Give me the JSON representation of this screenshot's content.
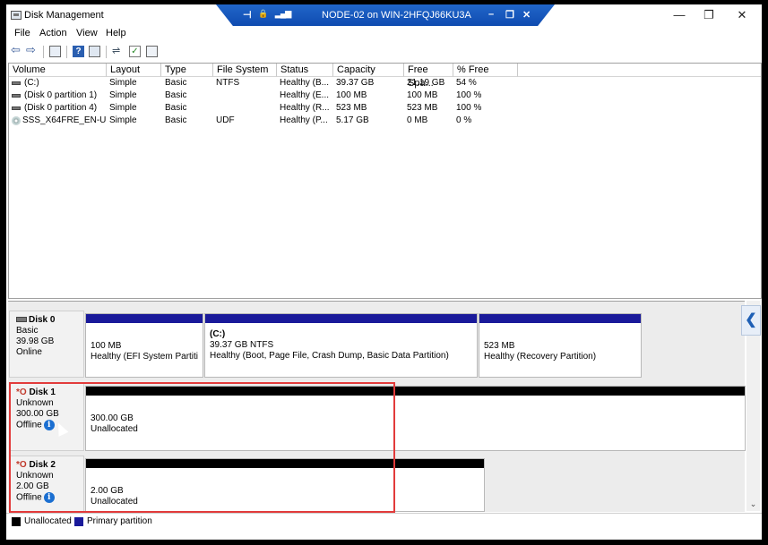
{
  "window": {
    "title": "Disk Management",
    "minimize": "—",
    "restore": "❐",
    "close": "✕"
  },
  "remote_bar": {
    "title": "NODE-02 on WIN-2HFQJ66KU3A",
    "pin": "⊣",
    "lock": "🔒",
    "signal": "▮",
    "minimize": "–",
    "restore": "❐",
    "close": "✕"
  },
  "menu": [
    "File",
    "Action",
    "View",
    "Help"
  ],
  "columns": [
    "Volume",
    "Layout",
    "Type",
    "File System",
    "Status",
    "Capacity",
    "Free Spa...",
    "% Free"
  ],
  "volumes": [
    {
      "volume": "(C:)",
      "layout": "Simple",
      "type": "Basic",
      "fs": "NTFS",
      "status": "Healthy (B...",
      "capacity": "39.37 GB",
      "free": "21.19 GB",
      "pct": "54 %",
      "icon": "drive-icon"
    },
    {
      "volume": "(Disk 0 partition 1)",
      "layout": "Simple",
      "type": "Basic",
      "fs": "",
      "status": "Healthy (E...",
      "capacity": "100 MB",
      "free": "100 MB",
      "pct": "100 %",
      "icon": "drive-icon"
    },
    {
      "volume": "(Disk 0 partition 4)",
      "layout": "Simple",
      "type": "Basic",
      "fs": "",
      "status": "Healthy (R...",
      "capacity": "523 MB",
      "free": "523 MB",
      "pct": "100 %",
      "icon": "drive-icon"
    },
    {
      "volume": "SSS_X64FRE_EN-U...",
      "layout": "Simple",
      "type": "Basic",
      "fs": "UDF",
      "status": "Healthy (P...",
      "capacity": "5.17 GB",
      "free": "0 MB",
      "pct": "0 %",
      "icon": "disc-icon"
    }
  ],
  "disks": [
    {
      "name": "Disk 0",
      "type": "Basic",
      "size": "39.98 GB",
      "state": "Online",
      "partitions": [
        {
          "label": "",
          "size": "100 MB",
          "status": "Healthy (EFI System Partitio"
        },
        {
          "label": "(C:)",
          "size": "39.37 GB NTFS",
          "status": "Healthy (Boot, Page File, Crash Dump, Basic Data Partition)"
        },
        {
          "label": "",
          "size": "523 MB",
          "status": "Healthy (Recovery Partition)"
        }
      ]
    },
    {
      "name": "Disk 1",
      "marker": "*O",
      "type": "Unknown",
      "size": "300.00 GB",
      "state": "Offline",
      "partitions": [
        {
          "size": "300.00 GB",
          "status": "Unallocated"
        }
      ]
    },
    {
      "name": "Disk 2",
      "marker": "*O",
      "type": "Unknown",
      "size": "2.00 GB",
      "state": "Offline",
      "partitions": [
        {
          "size": "2.00 GB",
          "status": "Unallocated"
        }
      ]
    }
  ],
  "legend": [
    {
      "label": "Unallocated",
      "color": "#000000"
    },
    {
      "label": "Primary partition",
      "color": "#1a1a9a"
    }
  ],
  "colors": {
    "primary": "#1a1a9a",
    "unallocated": "#000000",
    "highlight": "#e23b3b"
  },
  "info_glyph": "i",
  "collapse_glyph": "❮",
  "scroll_down_glyph": "⌄"
}
